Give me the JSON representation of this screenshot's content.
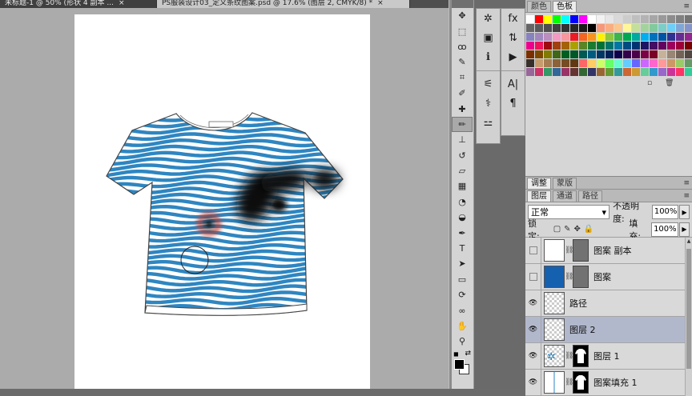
{
  "tabs": [
    {
      "label": "未标题-1 @ 50% (形状 4 副本 ...",
      "active": false
    },
    {
      "label": "PS服装设计03_定义条纹图案.psd @ 17.6% (图层 2, CMYK/8) *",
      "active": true
    }
  ],
  "toolbox": {
    "tools": [
      {
        "name": "move-tool",
        "glyph": "✥"
      },
      {
        "name": "marquee-tool",
        "glyph": "⬚"
      },
      {
        "name": "lasso-tool",
        "glyph": "ꝏ"
      },
      {
        "name": "quick-select-tool",
        "glyph": "✎"
      },
      {
        "name": "crop-tool",
        "glyph": "⌗"
      },
      {
        "name": "eyedropper-tool",
        "glyph": "✐"
      },
      {
        "name": "healing-brush-tool",
        "glyph": "✚"
      },
      {
        "name": "brush-tool",
        "glyph": "✏",
        "selected": true
      },
      {
        "name": "clone-stamp-tool",
        "glyph": "⊥"
      },
      {
        "name": "history-brush-tool",
        "glyph": "↺"
      },
      {
        "name": "eraser-tool",
        "glyph": "▱"
      },
      {
        "name": "gradient-tool",
        "glyph": "▦"
      },
      {
        "name": "blur-tool",
        "glyph": "◔"
      },
      {
        "name": "dodge-tool",
        "glyph": "◒"
      },
      {
        "name": "pen-tool",
        "glyph": "✒"
      },
      {
        "name": "type-tool",
        "glyph": "T"
      },
      {
        "name": "path-select-tool",
        "glyph": "➤"
      },
      {
        "name": "shape-tool",
        "glyph": "▭"
      },
      {
        "name": "3d-rotate-tool",
        "glyph": "⟳"
      },
      {
        "name": "3d-orbit-tool",
        "glyph": "∞"
      },
      {
        "name": "hand-tool",
        "glyph": "✋"
      },
      {
        "name": "zoom-tool",
        "glyph": "⚲"
      }
    ]
  },
  "dock": {
    "col1": [
      {
        "name": "navigator-icon",
        "glyph": "✲"
      },
      {
        "name": "histogram-icon",
        "glyph": "▣"
      },
      {
        "name": "info-icon",
        "glyph": "ℹ"
      },
      {
        "name": "brush-presets-icon",
        "glyph": "⚟"
      },
      {
        "name": "clone-source-icon",
        "glyph": "⚕"
      },
      {
        "name": "tool-presets-icon",
        "glyph": "⚍"
      }
    ],
    "col2": [
      {
        "name": "fx-styles-icon",
        "glyph": "fx"
      },
      {
        "name": "history-icon",
        "glyph": "⇅"
      },
      {
        "name": "actions-icon",
        "glyph": "▶"
      },
      {
        "name": "character-icon",
        "glyph": "A|"
      },
      {
        "name": "paragraph-icon",
        "glyph": "¶"
      }
    ]
  },
  "color_panel": {
    "tabs": [
      "颜色",
      "色板"
    ],
    "active_tab": 1,
    "swatches": [
      "#ffffff",
      "#ff0000",
      "#ffff00",
      "#00ff00",
      "#00ffff",
      "#0000ff",
      "#ff00ff",
      "#ffffff",
      "#f2f2f2",
      "#e6e6e6",
      "#d9d9d9",
      "#cccccc",
      "#bfbfbf",
      "#b3b3b3",
      "#a6a6a6",
      "#999999",
      "#8c8c8c",
      "#808080",
      "#737373",
      "#666666",
      "#595959",
      "#4d4d4d",
      "#404040",
      "#333333",
      "#262626",
      "#1a1a1a",
      "#000000",
      "#f7977a",
      "#f9ad81",
      "#fdc68a",
      "#fff79a",
      "#c4df9b",
      "#a3d39c",
      "#82ca9d",
      "#7bcdc8",
      "#6ecff6",
      "#7ea7d8",
      "#8493ca",
      "#8882be",
      "#a187be",
      "#bc8dbf",
      "#f49ac2",
      "#f6989d",
      "#ed1c24",
      "#f26522",
      "#f7941d",
      "#fff200",
      "#8dc63f",
      "#39b54a",
      "#00a651",
      "#00a99d",
      "#00aeef",
      "#0072bc",
      "#0054a6",
      "#2e3192",
      "#662d91",
      "#92278f",
      "#ec008c",
      "#ed145b",
      "#9e0b0f",
      "#a0410d",
      "#a36209",
      "#aba000",
      "#598527",
      "#1a7b30",
      "#007236",
      "#00746b",
      "#0076a3",
      "#004b80",
      "#003471",
      "#1b1464",
      "#440e62",
      "#630460",
      "#9e005d",
      "#9e0039",
      "#790000",
      "#7b2e00",
      "#7d4900",
      "#827b00",
      "#406618",
      "#005e20",
      "#005826",
      "#005952",
      "#005b7f",
      "#003663",
      "#002157",
      "#0d004c",
      "#32004b",
      "#4b0049",
      "#7b0046",
      "#7a0026",
      "#c7b299",
      "#998675",
      "#736357",
      "#534741",
      "#37302a",
      "#c69c6d",
      "#a67c52",
      "#8c6239",
      "#754c24",
      "#603913",
      "#ff6666",
      "#ffcc66",
      "#ccff66",
      "#66ff66",
      "#66ffcc",
      "#66ccff",
      "#6666ff",
      "#cc66ff",
      "#ff66cc",
      "#ff9999",
      "#cc9966",
      "#99cc66",
      "#669966",
      "#996699",
      "#cc3366",
      "#339966",
      "#336699",
      "#993366",
      "#663333",
      "#336633",
      "#333366",
      "#996633",
      "#669933",
      "#339999",
      "#cc6633",
      "#cc9933",
      "#66cc99",
      "#3399cc",
      "#9966cc",
      "#cc3399",
      "#ff3366",
      "#33cc99"
    ]
  },
  "adjust_tabs": [
    "调整",
    "蒙版"
  ],
  "layers_panel": {
    "tabs": [
      "图层",
      "通道",
      "路径"
    ],
    "blend_mode": "正常",
    "opacity_label": "不透明度:",
    "opacity": "100%",
    "lock_label": "锁定:",
    "fill_label": "填充:",
    "fill": "100%",
    "layers": [
      {
        "name": "图案 副本",
        "visible": false,
        "thumb": "white",
        "has_mask": true,
        "active": false
      },
      {
        "name": "图案",
        "visible": false,
        "thumb": "blue",
        "has_mask": true,
        "active": false
      },
      {
        "name": "路径",
        "visible": true,
        "thumb": "checker",
        "has_mask": false,
        "active": false
      },
      {
        "name": "图层 2",
        "visible": true,
        "thumb": "checker",
        "has_mask": false,
        "active": true
      },
      {
        "name": "图层 1",
        "visible": true,
        "thumb": "shirt",
        "has_mask": true,
        "active": false
      },
      {
        "name": "图案填充 1",
        "visible": true,
        "thumb": "line",
        "has_mask": true,
        "active": false
      }
    ]
  },
  "colors": {
    "stripe": "#2e86c1",
    "brush_ring": "#c0392b",
    "fg_color": "#000000",
    "bg_color": "#ffffff"
  }
}
